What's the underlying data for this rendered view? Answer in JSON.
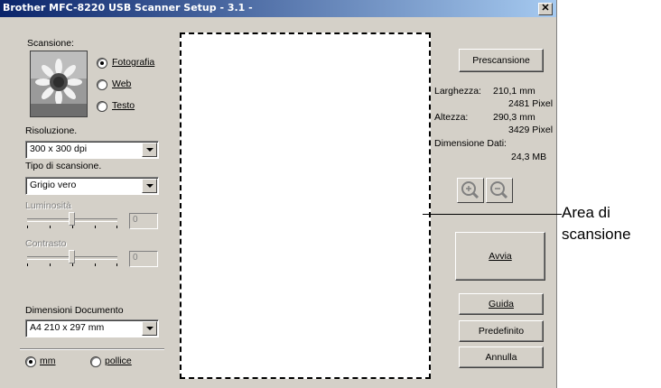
{
  "window": {
    "title": "Brother MFC-8220 USB Scanner Setup - 3.1 -",
    "close": "✕"
  },
  "scan": {
    "label": "Scansione:",
    "options": [
      {
        "label": "Fotografia",
        "selected": true
      },
      {
        "label": "Web",
        "selected": false
      },
      {
        "label": "Testo",
        "selected": false
      }
    ]
  },
  "resolution": {
    "label": "Risoluzione.",
    "value": "300 x 300 dpi"
  },
  "scan_type": {
    "label": "Tipo di scansione.",
    "value": "Grigio vero"
  },
  "brightness": {
    "label": "Luminosità",
    "value": "0",
    "level": 0.5,
    "disabled": true
  },
  "contrast": {
    "label": "Contrasto",
    "value": "0",
    "level": 0.5,
    "disabled": true
  },
  "doc_size": {
    "label": "Dimensioni Documento",
    "value": "A4 210 x 297 mm"
  },
  "units": [
    {
      "label": "mm",
      "selected": true
    },
    {
      "label": "pollice",
      "selected": false
    }
  ],
  "buttons": {
    "prescan": "Prescansione",
    "start": "Avvia",
    "help": "Guida",
    "default": "Predefinito",
    "cancel": "Annulla"
  },
  "info": {
    "width_label": "Larghezza:",
    "width_mm": "210,1 mm",
    "width_px": "2481 Pixel",
    "height_label": "Altezza:",
    "height_mm": "290,3 mm",
    "height_px": "3429 Pixel",
    "data_label": "Dimensione Dati:",
    "data_size": "24,3 MB"
  },
  "icons": {
    "zoom_in": "zoom-in-icon",
    "zoom_out": "zoom-out-icon"
  },
  "callout": {
    "line1": "Area di",
    "line2": "scansione"
  }
}
